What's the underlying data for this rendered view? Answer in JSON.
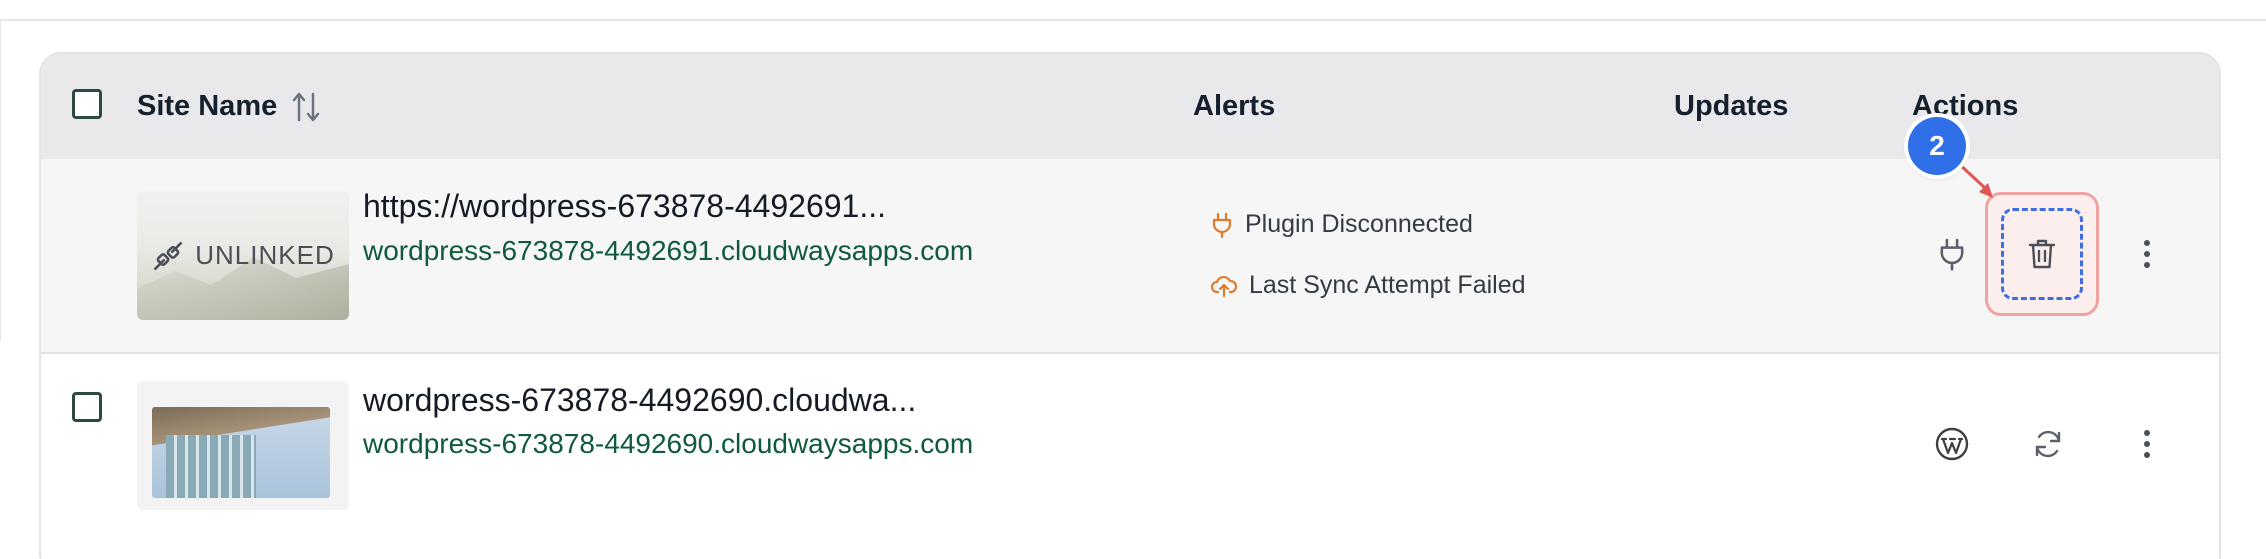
{
  "table": {
    "headers": {
      "site_name": "Site Name",
      "alerts": "Alerts",
      "updates": "Updates",
      "actions": "Actions"
    },
    "rows": [
      {
        "selected": false,
        "thumbnail_label": "UNLINKED",
        "title": "https://wordpress-673878-4492691...",
        "url": "wordpress-673878-4492691.cloudwaysapps.com",
        "alerts": [
          {
            "icon": "plug-icon",
            "text": "Plugin Disconnected"
          },
          {
            "icon": "cloud-upload-icon",
            "text": "Last Sync Attempt Failed"
          }
        ],
        "actions": [
          "plug-icon",
          "trash-icon",
          "more-vertical-icon"
        ]
      },
      {
        "selected": false,
        "thumbnail": "building-photo",
        "title": "wordpress-673878-4492690.cloudwa...",
        "url": "wordpress-673878-4492690.cloudwaysapps.com",
        "alerts": [],
        "actions": [
          "wordpress-icon",
          "refresh-icon",
          "more-vertical-icon"
        ]
      }
    ]
  },
  "annotation": {
    "step_number": "2",
    "target": "trash-icon"
  },
  "colors": {
    "header_bg": "#e9e9ec",
    "url_green": "#0f5a3a",
    "alert_orange": "#e07a2b",
    "highlight_red": "#f0a3a3",
    "badge_blue": "#2f6fe8"
  }
}
